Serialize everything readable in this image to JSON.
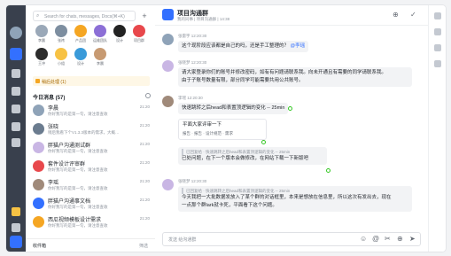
{
  "search": {
    "placeholder": "Search for chats, messages, Docs(⌘+K)"
  },
  "contacts": [
    {
      "name": "李晨",
      "color": "#9aa8b8"
    },
    {
      "name": "张祎",
      "color": "#7d8ea0"
    },
    {
      "name": "产品团",
      "color": "#f5a623"
    },
    {
      "name": "运维团队",
      "color": "#8c6fd6"
    },
    {
      "name": "设计",
      "color": "#222222"
    },
    {
      "name": "项目群",
      "color": "#e8484c"
    },
    {
      "name": "王冲",
      "color": "#2c2c2c"
    },
    {
      "name": "小组",
      "color": "#f7c244"
    },
    {
      "name": "设计",
      "color": "#3a9ad9"
    },
    {
      "name": "李晨",
      "color": "#c79a72"
    }
  ],
  "notice": {
    "text": "稍后处理 (1)"
  },
  "section": {
    "title": "今日消息 (57)"
  },
  "chats": [
    {
      "title": "李晨",
      "preview": "你好我写的是第一句，请注意查收",
      "time": "21:20",
      "color": "#8fa3b8"
    },
    {
      "title": "张晓",
      "preview": "稍后我看下个V1.3.3版本的需求，大概…",
      "time": "21:20",
      "color": "#6b7c8f"
    },
    {
      "title": "胖猫户沟通测试群",
      "preview": "你好我写的是第一句，请注意查收",
      "time": "21:20",
      "color": "#c9b6e4"
    },
    {
      "title": "套件设计评审群",
      "preview": "你好我写的是第一句，请注意查收",
      "time": "21:20",
      "color": "#e8484c"
    },
    {
      "title": "李瑶",
      "preview": "你好我写的是第一句，请注意查收",
      "time": "21:20",
      "color": "#a08a7a"
    },
    {
      "title": "胖猫户沟通事文档",
      "preview": "你好我写的是第一句，请注意查收",
      "time": "21:20",
      "color": "#3370ff"
    },
    {
      "title": "西瓜视频模板设计需求",
      "preview": "你好我写的是第一句，请注意查收",
      "time": "21:20",
      "color": "#f5a623"
    }
  ],
  "sidefoot": {
    "left": "收件箱",
    "right": "筛选"
  },
  "header": {
    "title": "项目沟通群",
    "subtitle": "我的同事 | 项目沟通群 | 14:38"
  },
  "messages": [
    {
      "who": "张雷宇  12:20:30",
      "text": "这个现阶段应该都是自己的吗，还是手工整理的？",
      "mention": "@李瑶",
      "color": "#8fa3b8"
    },
    {
      "who": "张晓梦  12:20:30",
      "text1": "请大家登录你们的账号并修改密码，如有有问题请联系我。向未开通且有需要的同学请联系我。",
      "text2": "由于子账号数量有限，部分同学可能需要共用公共账号。",
      "color": "#c9b6e4"
    },
    {
      "who": "李瑶  12:20:30",
      "text": "快速跳转之后head和表置顶逻辑的变化 -- 25min",
      "color": "#a08a7a"
    },
    {
      "card_title": "平面大家评审一下",
      "card_items": [
        "报告",
        "报告",
        "设计规范",
        "需求"
      ]
    },
    {
      "quote": "已回复给 · 快速跳转之后head和表置顶逻辑的变化 -- 25min",
      "text": "已处问题，在下一个版本会做修改，在网站下载一下新版吧"
    },
    {
      "who": "张晓梦  12:20:30",
      "quote": "已回复给 · 快速跳转之后head和表置顶逻辑的变化 -- 25min",
      "text1": "今天我把一大批数据发放入了某个群的对话框里，本来是想放在信息里，所以这次有发出去，现在",
      "text2": "一点那个群lark就卡死，平面看下这个问题。",
      "color": "#c9b6e4"
    }
  ],
  "compose": {
    "placeholder": "发送 给沟通群"
  }
}
